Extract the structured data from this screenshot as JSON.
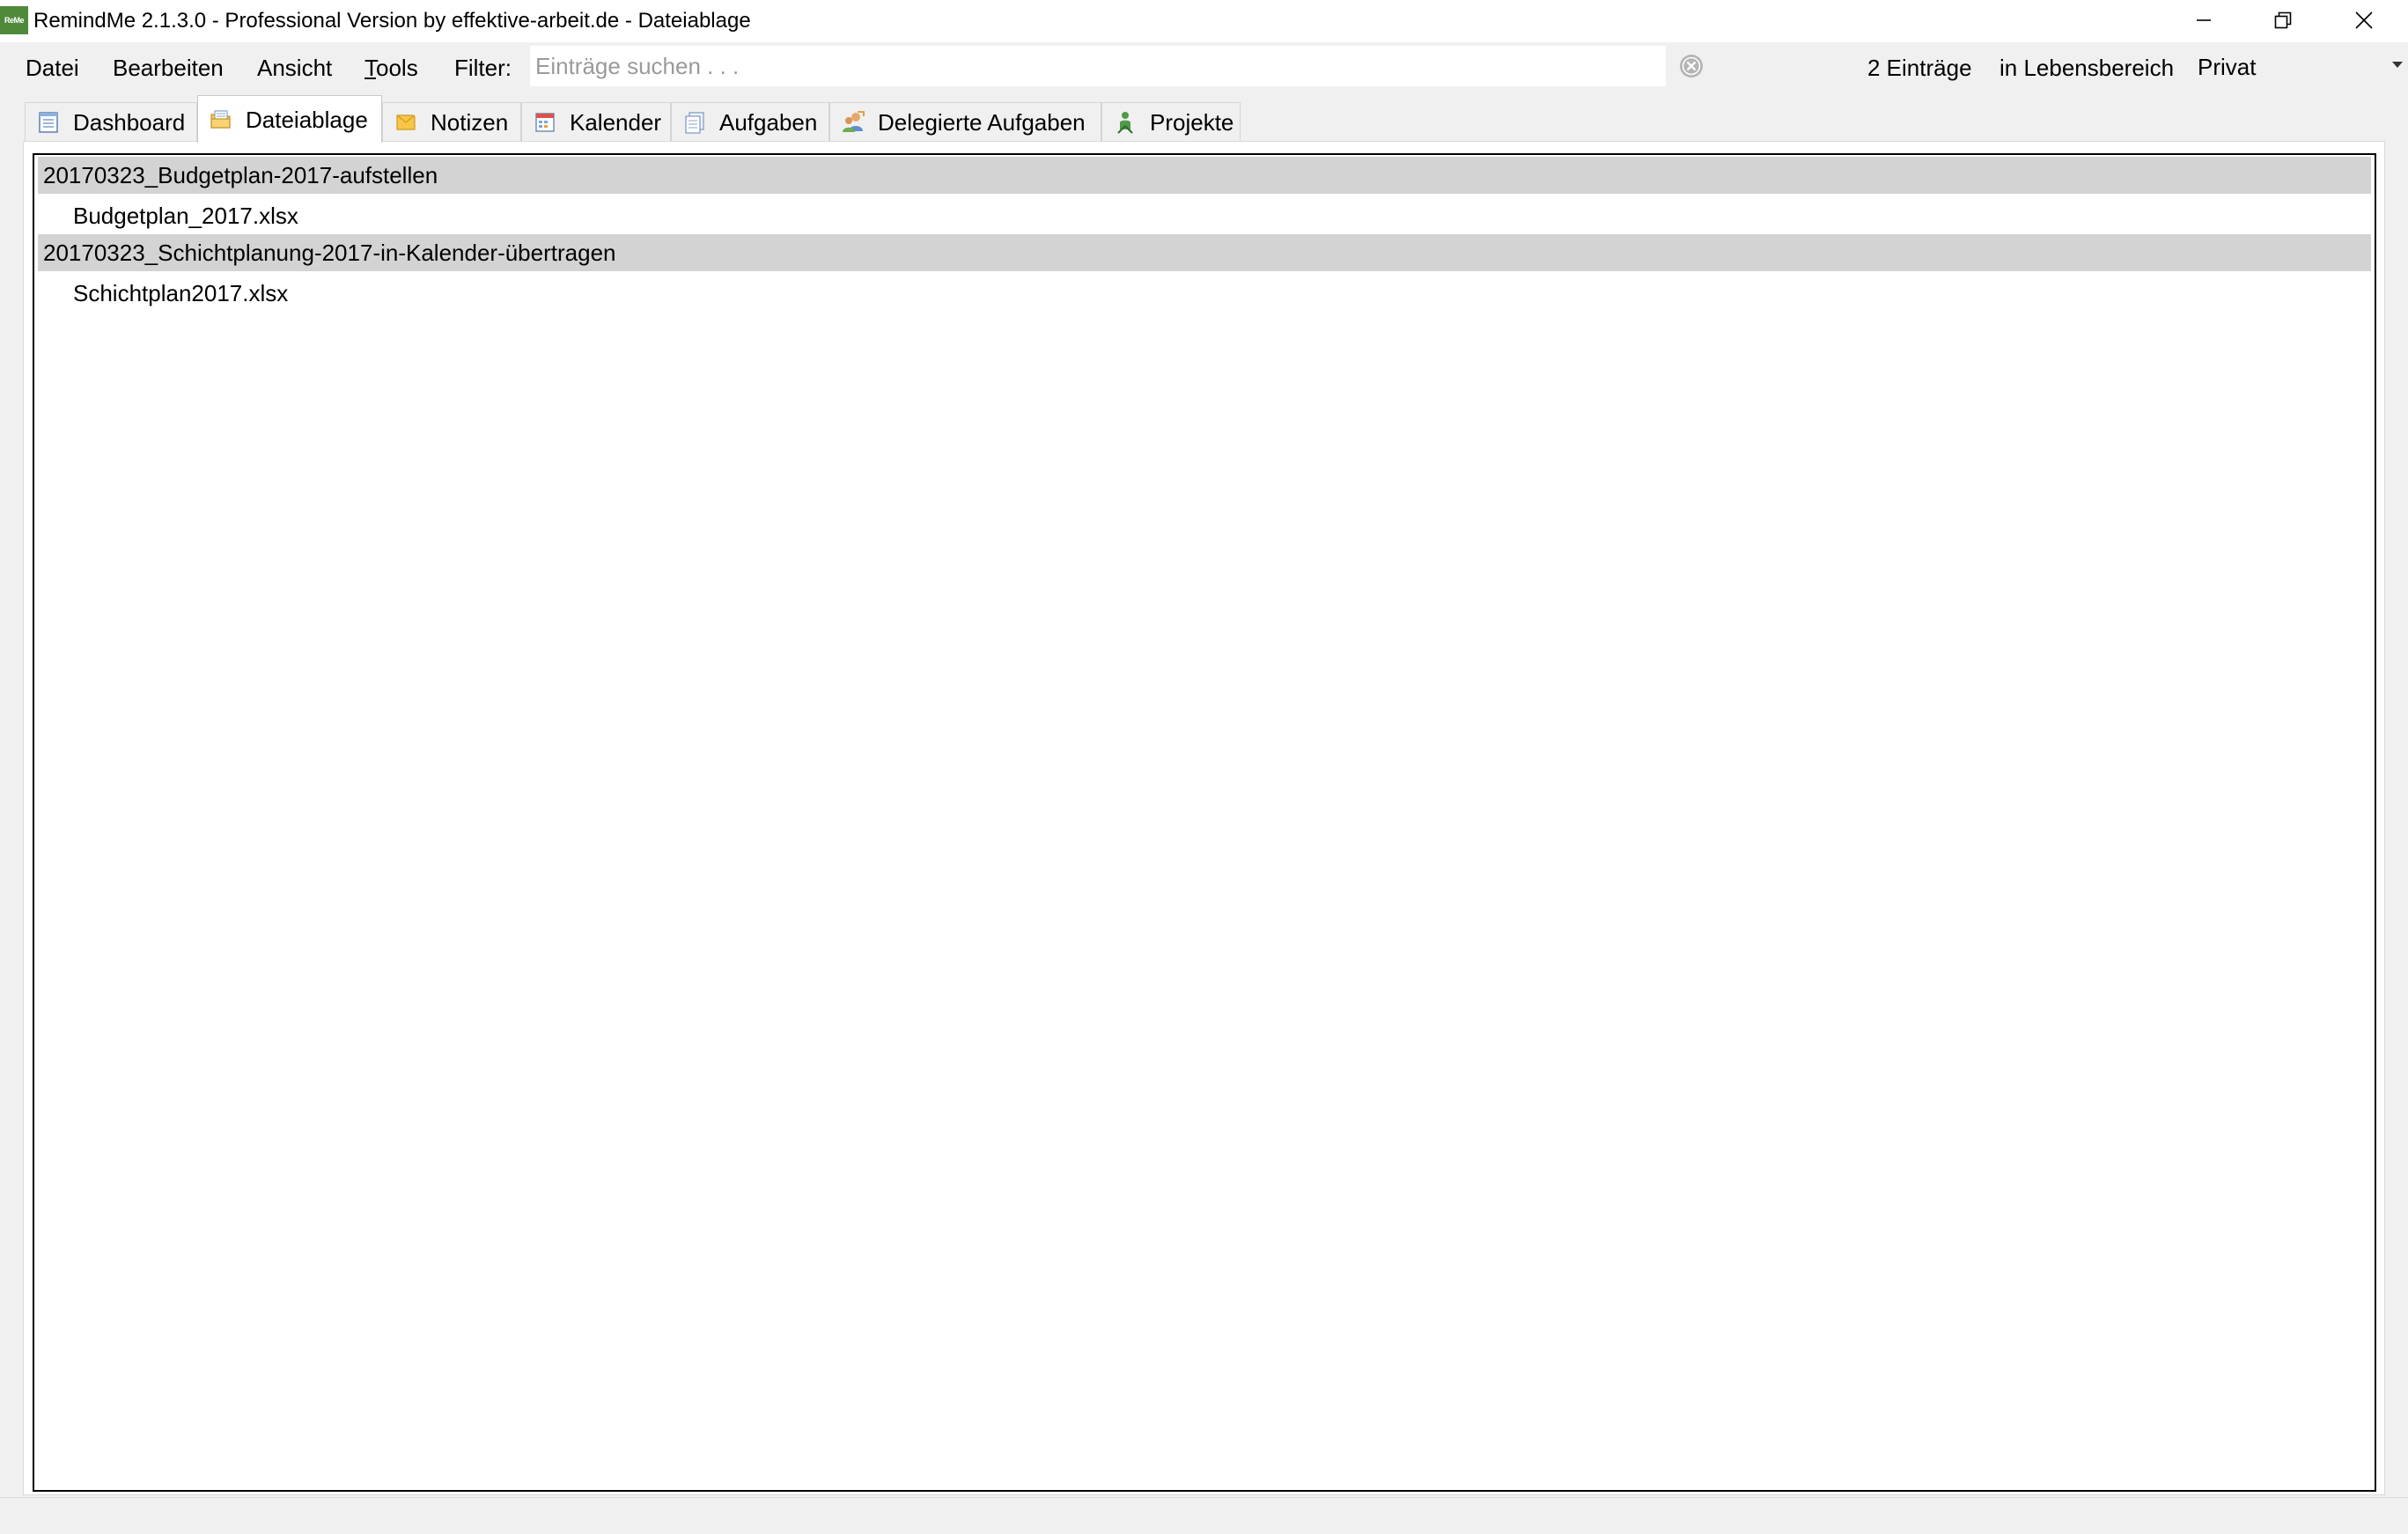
{
  "window": {
    "app_icon_text": "ReMe",
    "title": "RemindMe 2.1.3.0 - Professional Version by effektive-arbeit.de - Dateiablage"
  },
  "menu": {
    "datei": "Datei",
    "bearbeiten": "Bearbeiten",
    "ansicht": "Ansicht",
    "tools": "Tools",
    "filter_label": "Filter:"
  },
  "search": {
    "placeholder": "Einträge suchen . . .",
    "value": ""
  },
  "status": {
    "count": "2 Einträge",
    "area_label": "in Lebensbereich",
    "area_value": "Privat"
  },
  "tabs": [
    {
      "label": "Dashboard",
      "icon": "dashboard-icon",
      "active": false
    },
    {
      "label": "Dateiablage",
      "icon": "folder-icon",
      "active": true
    },
    {
      "label": "Notizen",
      "icon": "notes-icon",
      "active": false
    },
    {
      "label": "Kalender",
      "icon": "calendar-icon",
      "active": false
    },
    {
      "label": "Aufgaben",
      "icon": "tasks-icon",
      "active": false
    },
    {
      "label": "Delegierte Aufgaben",
      "icon": "delegated-tasks-icon",
      "active": false
    },
    {
      "label": "Projekte",
      "icon": "projects-icon",
      "active": false
    }
  ],
  "files": {
    "groups": [
      {
        "name": "20170323_Budgetplan-2017-aufstellen",
        "items": [
          "Budgetplan_2017.xlsx"
        ]
      },
      {
        "name": "20170323_Schichtplanung-2017-in-Kalender-übertragen",
        "items": [
          "Schichtplan2017.xlsx"
        ]
      }
    ]
  },
  "colors": {
    "group_row_bg": "#d3d3d3",
    "window_bg": "#f0f0f0",
    "app_icon_bg": "#4f8a3a"
  }
}
